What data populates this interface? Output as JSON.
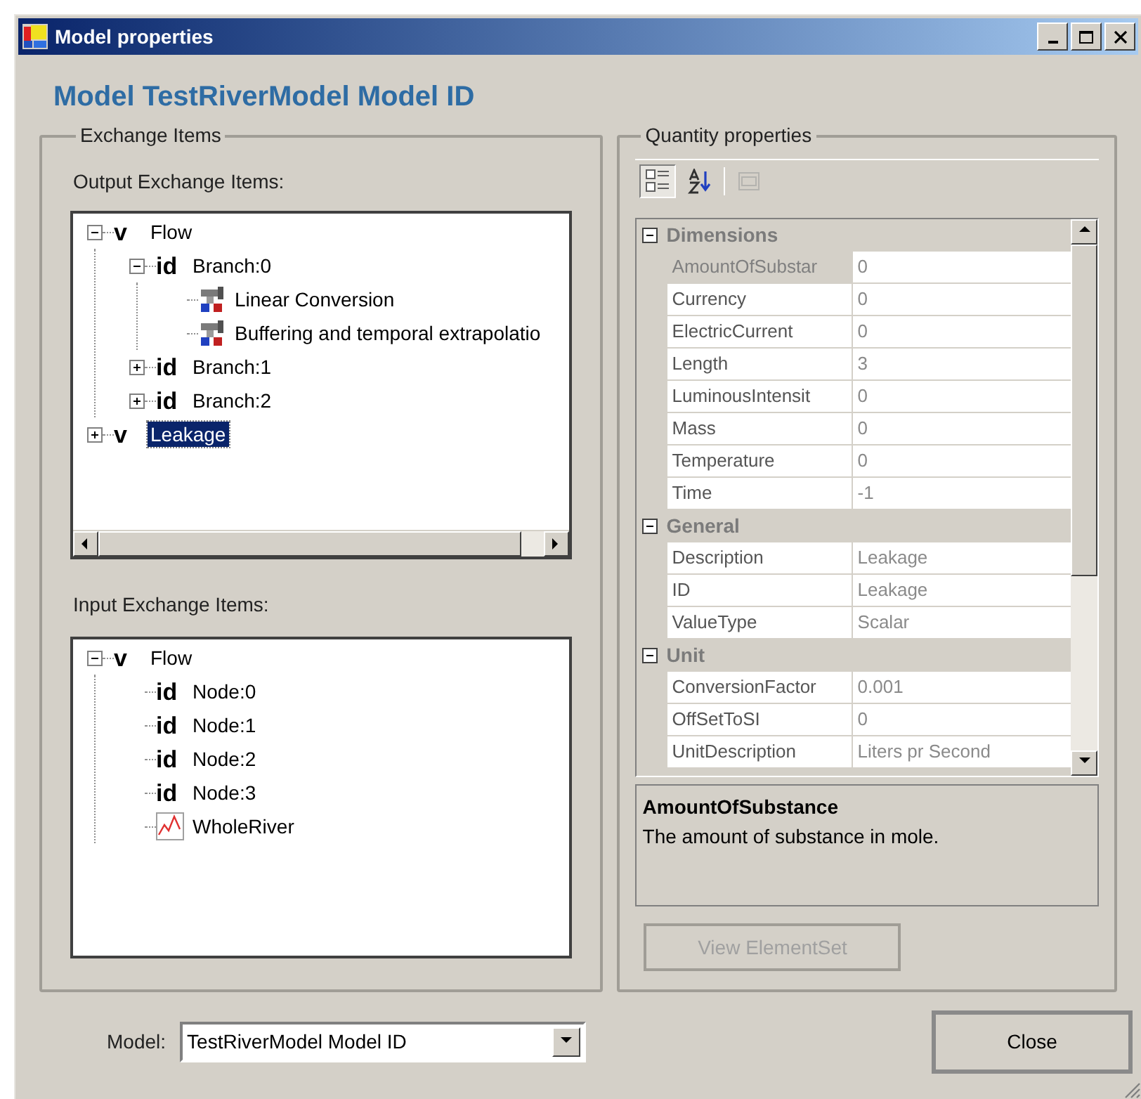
{
  "window": {
    "title": "Model properties"
  },
  "heading": "Model TestRiverModel Model ID",
  "exchange_items": {
    "legend": "Exchange Items",
    "output": {
      "label": "Output Exchange Items:",
      "nodes": [
        {
          "kind": "quantity",
          "glyph": "v",
          "label": "Flow",
          "expanded": true,
          "selected": false,
          "children": [
            {
              "kind": "elementset",
              "glyph": "id",
              "label": "Branch:0",
              "expanded": true,
              "selected": false,
              "children": [
                {
                  "kind": "operation",
                  "label": "Linear Conversion",
                  "selected": false
                },
                {
                  "kind": "operation",
                  "label": "Buffering and temporal extrapolatio",
                  "selected": false
                }
              ]
            },
            {
              "kind": "elementset",
              "glyph": "id",
              "label": "Branch:1",
              "expanded": false,
              "selected": false
            },
            {
              "kind": "elementset",
              "glyph": "id",
              "label": "Branch:2",
              "expanded": false,
              "selected": false
            }
          ]
        },
        {
          "kind": "quantity",
          "glyph": "v",
          "label": "Leakage",
          "expanded": false,
          "selected": true
        }
      ]
    },
    "input": {
      "label": "Input Exchange Items:",
      "nodes": [
        {
          "kind": "quantity",
          "glyph": "v",
          "label": "Flow",
          "expanded": true,
          "selected": false,
          "children": [
            {
              "kind": "elementset",
              "glyph": "id",
              "label": "Node:0",
              "selected": false
            },
            {
              "kind": "elementset",
              "glyph": "id",
              "label": "Node:1",
              "selected": false
            },
            {
              "kind": "elementset",
              "glyph": "id",
              "label": "Node:2",
              "selected": false
            },
            {
              "kind": "elementset",
              "glyph": "id",
              "label": "Node:3",
              "selected": false
            },
            {
              "kind": "chart",
              "label": "WholeRiver",
              "selected": false
            }
          ]
        }
      ]
    }
  },
  "quantity_properties": {
    "legend": "Quantity properties",
    "toolbar": [
      {
        "kind": "categorized",
        "selected": true
      },
      {
        "kind": "alphabetical",
        "selected": false
      },
      {
        "kind": "pages",
        "selected": false,
        "disabled": true
      }
    ],
    "categories": [
      {
        "name": "Dimensions",
        "expanded": true,
        "properties": [
          {
            "name": "AmountOfSubstar",
            "value": "0",
            "selected": true
          },
          {
            "name": "Currency",
            "value": "0",
            "selected": false
          },
          {
            "name": "ElectricCurrent",
            "value": "0",
            "selected": false
          },
          {
            "name": "Length",
            "value": "3",
            "selected": false
          },
          {
            "name": "LuminousIntensit",
            "value": "0",
            "selected": false
          },
          {
            "name": "Mass",
            "value": "0",
            "selected": false
          },
          {
            "name": "Temperature",
            "value": "0",
            "selected": false
          },
          {
            "name": "Time",
            "value": "-1",
            "selected": false
          }
        ]
      },
      {
        "name": "General",
        "expanded": true,
        "properties": [
          {
            "name": "Description",
            "value": "Leakage",
            "selected": false
          },
          {
            "name": "ID",
            "value": "Leakage",
            "selected": false
          },
          {
            "name": "ValueType",
            "value": "Scalar",
            "selected": false
          }
        ]
      },
      {
        "name": "Unit",
        "expanded": true,
        "properties": [
          {
            "name": "ConversionFactor",
            "value": "0.001",
            "selected": false
          },
          {
            "name": "OffSetToSI",
            "value": "0",
            "selected": false
          },
          {
            "name": "UnitDescription",
            "value": "Liters pr Second",
            "selected": false
          }
        ]
      }
    ],
    "description": {
      "title": "AmountOfSubstance",
      "text": "The amount of substance in mole."
    },
    "button": {
      "label": "View ElementSet",
      "disabled": true
    }
  },
  "model_select": {
    "label": "Model:",
    "value": "TestRiverModel Model ID"
  },
  "close_button": "Close"
}
